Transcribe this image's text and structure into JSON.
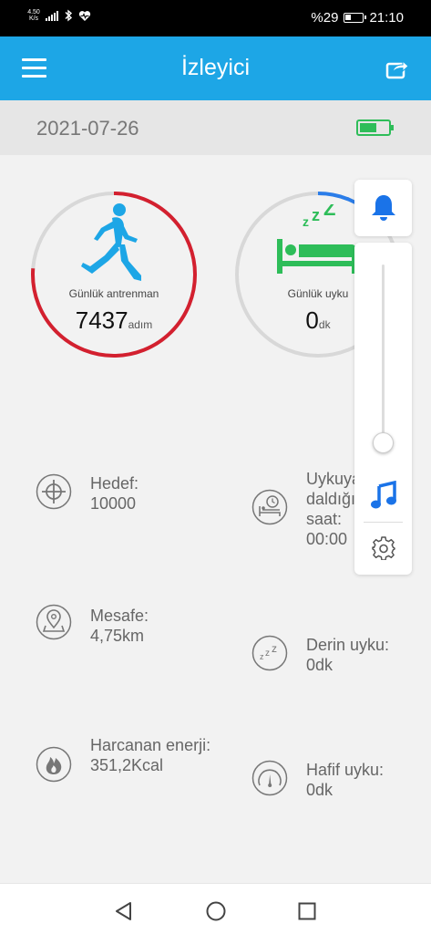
{
  "status_bar": {
    "net_speed_top": "4.50",
    "net_speed_bottom": "K/s",
    "battery_percent": "%29",
    "time": "21:10"
  },
  "app_bar": {
    "title": "İzleyici"
  },
  "date_bar": {
    "date": "2021-07-26",
    "battery_level": 0.6,
    "battery_color": "#2ebd59"
  },
  "training_ring": {
    "label": "Günlük antrenman",
    "value": "7437",
    "unit": "adım",
    "progress_color": "#d3202f"
  },
  "sleep_ring": {
    "label": "Günlük uyku",
    "value": "0",
    "unit": "dk",
    "progress_color": "#2b7de9"
  },
  "stats_left": [
    {
      "icon": "target-icon",
      "label": "Hedef:",
      "value": "10000"
    },
    {
      "icon": "location-icon",
      "label": "Mesafe:",
      "value": "4,75km"
    },
    {
      "icon": "flame-icon",
      "label": "Harcanan enerji:",
      "value": "351,2Kcal"
    }
  ],
  "stats_right": [
    {
      "icon": "bed-clock-icon",
      "label": "Uykuya daldığı saat:",
      "value": "00:00"
    },
    {
      "icon": "zzz-icon",
      "label": "Derin uyku:",
      "value": "0dk"
    },
    {
      "icon": "gauge-icon",
      "label": "Hafif uyku:",
      "value": "0dk"
    }
  ],
  "side_panel": {
    "accent_color": "#1a73e8"
  },
  "colors": {
    "app_bar": "#1da6e6",
    "page_background": "#f2f2f2"
  }
}
